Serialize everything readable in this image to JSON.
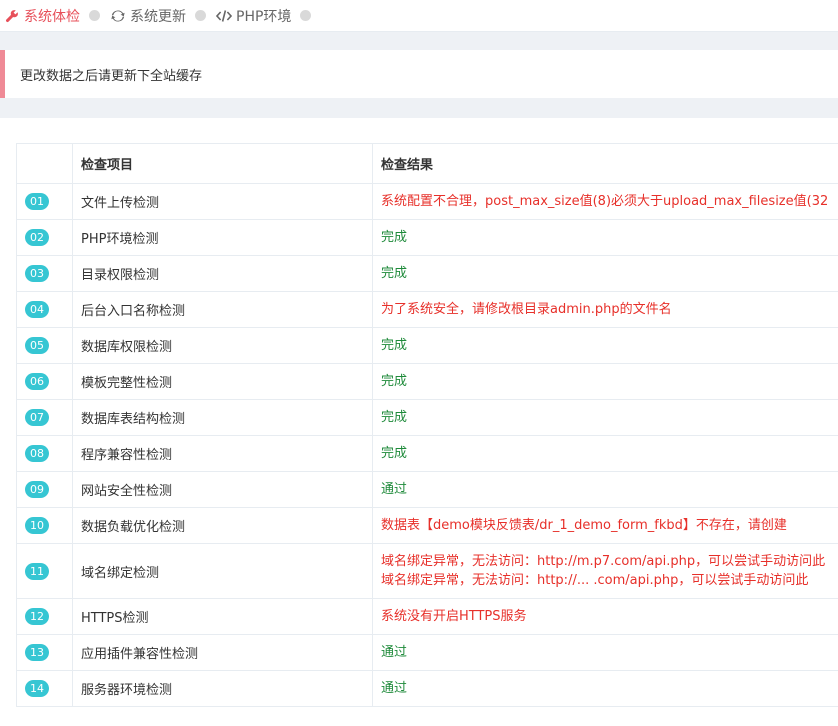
{
  "tabs": [
    {
      "label": "系统体检",
      "icon": "wrench-icon",
      "active": true
    },
    {
      "label": "系统更新",
      "icon": "refresh-icon",
      "active": false
    },
    {
      "label": "PHP环境",
      "icon": "code-icon",
      "active": false
    }
  ],
  "notice": "更改数据之后请更新下全站缓存",
  "table": {
    "headers": [
      "",
      "检查项目",
      "检查结果"
    ],
    "rows": [
      {
        "num": "01",
        "item": "文件上传检测",
        "status": "error",
        "results": [
          "系统配置不合理，post_max_size值(8)必须大于upload_max_filesize值(32"
        ]
      },
      {
        "num": "02",
        "item": "PHP环境检测",
        "status": "ok",
        "results": [
          "完成"
        ]
      },
      {
        "num": "03",
        "item": "目录权限检测",
        "status": "ok",
        "results": [
          "完成"
        ]
      },
      {
        "num": "04",
        "item": "后台入口名称检测",
        "status": "error",
        "results": [
          "为了系统安全，请修改根目录admin.php的文件名"
        ]
      },
      {
        "num": "05",
        "item": "数据库权限检测",
        "status": "ok",
        "results": [
          "完成"
        ]
      },
      {
        "num": "06",
        "item": "模板完整性检测",
        "status": "ok",
        "results": [
          "完成"
        ]
      },
      {
        "num": "07",
        "item": "数据库表结构检测",
        "status": "ok",
        "results": [
          "完成"
        ]
      },
      {
        "num": "08",
        "item": "程序兼容性检测",
        "status": "ok",
        "results": [
          "完成"
        ]
      },
      {
        "num": "09",
        "item": "网站安全性检测",
        "status": "ok",
        "results": [
          "通过"
        ]
      },
      {
        "num": "10",
        "item": "数据负载优化检测",
        "status": "error",
        "results": [
          "数据表【demo模块反馈表/dr_1_demo_form_fkbd】不存在，请创建"
        ]
      },
      {
        "num": "11",
        "item": "域名绑定检测",
        "status": "error",
        "results": [
          "域名绑定异常，无法访问：http://m.p7.com/api.php，可以尝试手动访问此",
          "域名绑定异常，无法访问：http://... .com/api.php，可以尝试手动访问此"
        ]
      },
      {
        "num": "12",
        "item": "HTTPS检测",
        "status": "error",
        "results": [
          "系统没有开启HTTPS服务"
        ]
      },
      {
        "num": "13",
        "item": "应用插件兼容性检测",
        "status": "ok",
        "results": [
          "通过"
        ]
      },
      {
        "num": "14",
        "item": "服务器环境检测",
        "status": "ok",
        "results": [
          "通过"
        ]
      }
    ]
  },
  "colors": {
    "accent": "#e7505a",
    "badge": "#36c6d3",
    "ok": "#1e8a3a",
    "error": "#e7302a",
    "note_border": "#ef8a96"
  }
}
